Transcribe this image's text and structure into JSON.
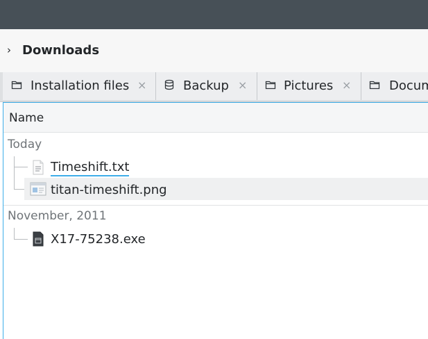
{
  "breadcrumb": {
    "chevron": "›",
    "label": "Downloads"
  },
  "tabs": [
    {
      "label": "Installation files",
      "icon": "folder-icon",
      "close": "×"
    },
    {
      "label": "Backup",
      "icon": "database-icon",
      "close": "×"
    },
    {
      "label": "Pictures",
      "icon": "folder-icon",
      "close": "×"
    },
    {
      "label": "Docum",
      "icon": "folder-icon"
    }
  ],
  "header": {
    "name_column": "Name"
  },
  "groups": [
    {
      "label": "Today",
      "files": [
        {
          "name": "Timeshift.txt",
          "icon": "text-file-icon",
          "state": "focused"
        },
        {
          "name": "titan-timeshift.png",
          "icon": "image-file-icon",
          "state": "hovered"
        }
      ]
    },
    {
      "label": "November, 2011",
      "files": [
        {
          "name": "X17-75238.exe",
          "icon": "executable-file-icon"
        }
      ]
    }
  ],
  "colors": {
    "accent": "#3daee9",
    "titlebar": "#475057",
    "text": "#232629"
  }
}
